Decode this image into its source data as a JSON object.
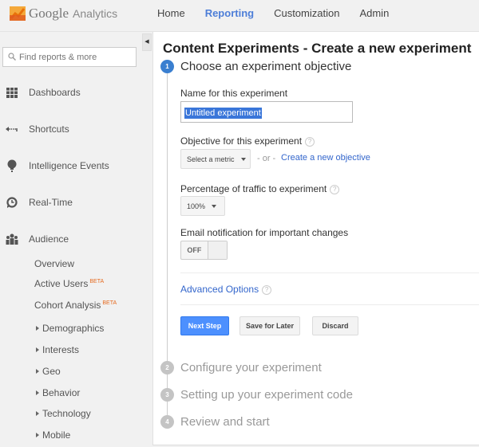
{
  "app": {
    "logo_google": "Google",
    "logo_analytics": "Analytics",
    "brand_colors": {
      "orange": "#f4a83a",
      "accent_blue": "#4d90fe",
      "beta_orange": "#e56a1f"
    }
  },
  "nav": {
    "items": [
      {
        "label": "Home",
        "active": false
      },
      {
        "label": "Reporting",
        "active": true
      },
      {
        "label": "Customization",
        "active": false
      },
      {
        "label": "Admin",
        "active": false
      }
    ]
  },
  "sidebar": {
    "search_placeholder": "Find reports & more",
    "collapse_glyph": "◀",
    "items": [
      {
        "label": "Dashboards",
        "icon": "grid-icon"
      },
      {
        "label": "Shortcuts",
        "icon": "shortcut-arrow-icon"
      },
      {
        "label": "Intelligence Events",
        "icon": "lightbulb-icon"
      },
      {
        "label": "Real-Time",
        "icon": "clock-icon"
      },
      {
        "label": "Audience",
        "icon": "people-icon"
      }
    ],
    "audience_sub": [
      {
        "label": "Overview",
        "badge": ""
      },
      {
        "label": "Active Users",
        "badge": "BETA"
      },
      {
        "label": "Cohort Analysis",
        "badge": "BETA"
      },
      {
        "label": "Demographics",
        "expandable": true
      },
      {
        "label": "Interests",
        "expandable": true
      },
      {
        "label": "Geo",
        "expandable": true
      },
      {
        "label": "Behavior",
        "expandable": true
      },
      {
        "label": "Technology",
        "expandable": true
      },
      {
        "label": "Mobile",
        "expandable": true
      }
    ]
  },
  "main": {
    "title": "Content Experiments - Create a new experiment",
    "steps": [
      {
        "number": "1",
        "title": "Choose an experiment objective",
        "active": true
      },
      {
        "number": "2",
        "title": "Configure your experiment",
        "active": false
      },
      {
        "number": "3",
        "title": "Setting up your experiment code",
        "active": false
      },
      {
        "number": "4",
        "title": "Review and start",
        "active": false
      }
    ],
    "form": {
      "name_label": "Name for this experiment",
      "name_value": "Untitled experiment",
      "objective_label": "Objective for this experiment",
      "objective_select": "Select a metric",
      "or_text": "- or -",
      "create_objective_link": "Create a new objective",
      "traffic_label": "Percentage of traffic to experiment",
      "traffic_select": "100%",
      "email_label": "Email notification for important changes",
      "email_toggle": "OFF",
      "advanced_options": "Advanced Options",
      "help_glyph": "?"
    },
    "buttons": {
      "next": "Next Step",
      "save": "Save for Later",
      "discard": "Discard"
    }
  }
}
